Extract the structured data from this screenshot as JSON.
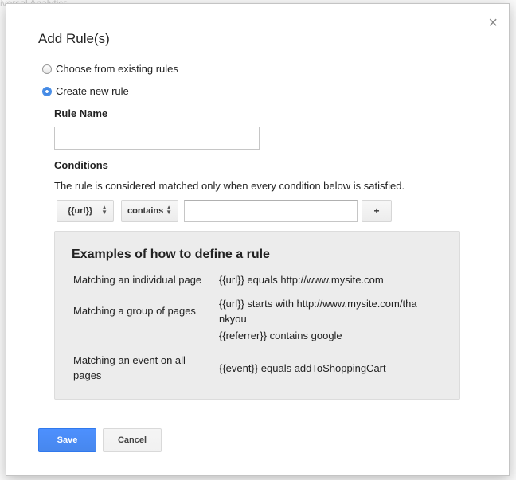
{
  "background": {
    "top_label": "iversal Analytics"
  },
  "dialog": {
    "title": "Add Rule(s)",
    "close_label": "×",
    "options": [
      {
        "label": "Choose from existing rules",
        "checked": false
      },
      {
        "label": "Create new rule",
        "checked": true
      }
    ],
    "rule_name": {
      "label": "Rule Name",
      "value": "",
      "placeholder": ""
    },
    "conditions": {
      "label": "Conditions",
      "description": "The rule is considered matched only when every condition below is satisfied.",
      "variable_select": "{{url}}",
      "operator_select": "contains",
      "value": "",
      "add_label": "+"
    },
    "examples": {
      "title": "Examples of how to define a rule",
      "rows": [
        {
          "case": "Matching an individual page",
          "rule": "{{url}} equals http://www.mysite.com"
        },
        {
          "case": "Matching a group of pages",
          "rule": "{{url}} starts with http://www.mysite.com/thankyou",
          "rule2": "{{referrer}} contains google"
        },
        {
          "case": "Matching an event on all pages",
          "rule": "{{event}} equals addToShoppingCart"
        }
      ]
    },
    "buttons": {
      "save": "Save",
      "cancel": "Cancel"
    }
  },
  "colors": {
    "primary": "#4d90fe",
    "examples_bg": "#ececec"
  }
}
